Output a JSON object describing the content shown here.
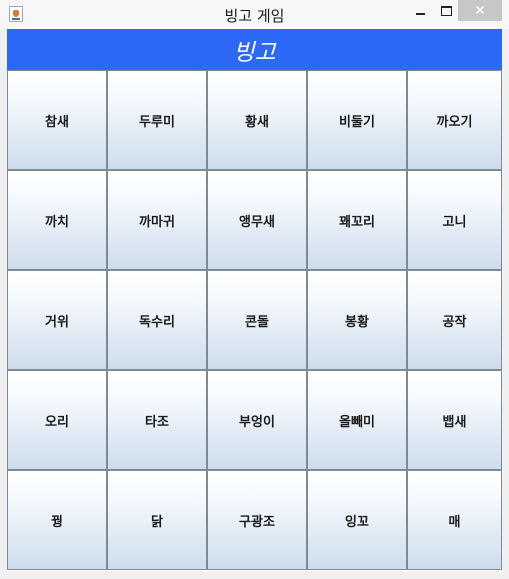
{
  "window": {
    "title": "빙고 게임",
    "close_glyph": "✕"
  },
  "header": {
    "title": "빙고"
  },
  "board": {
    "cells": [
      "참새",
      "두루미",
      "황새",
      "비둘기",
      "까오기",
      "까치",
      "까마귀",
      "앵무새",
      "꽤꼬리",
      "고니",
      "거위",
      "독수리",
      "콘돌",
      "봉황",
      "공작",
      "오리",
      "타조",
      "부엉이",
      "올빼미",
      "뱁새",
      "꿩",
      "닭",
      "구광조",
      "잉꼬",
      "매"
    ]
  }
}
